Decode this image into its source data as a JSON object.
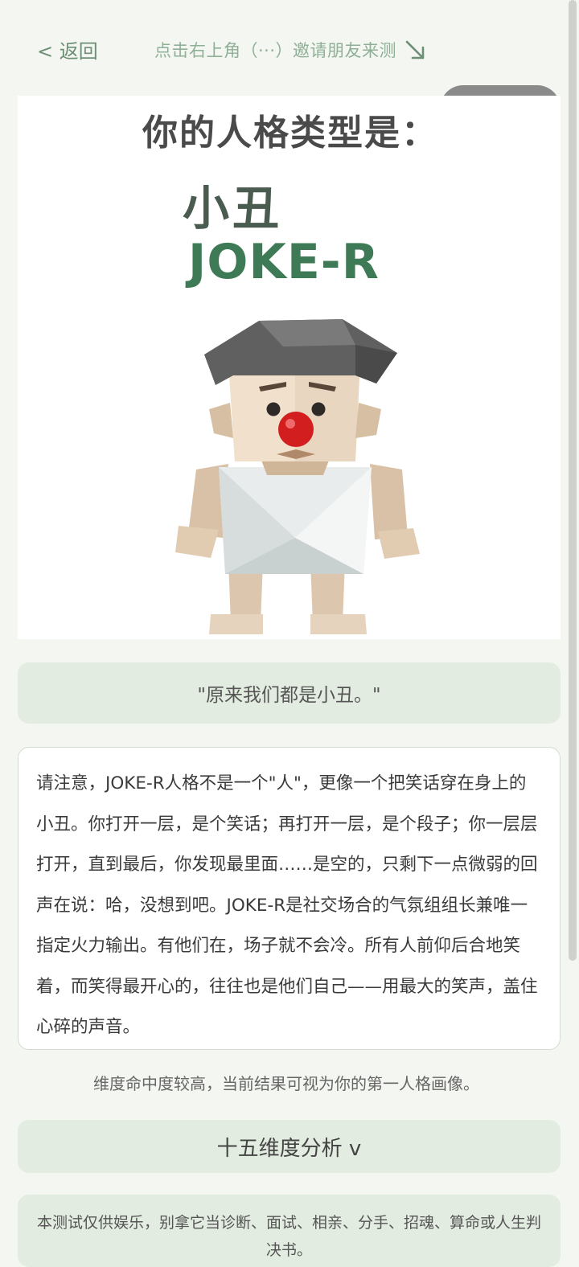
{
  "nav": {
    "back_label": "< 返回",
    "invite_text": "点击右上角（···）邀请朋友来测"
  },
  "hero": {
    "heading": "你的人格类型是：",
    "type_name": "小丑",
    "type_code": "JOKE-R"
  },
  "quote": "\"原来我们都是小丑。\"",
  "description": "请注意，JOKE-R人格不是一个\"人\"，更像一个把笑话穿在身上的小丑。你打开一层，是个笑话；再打开一层，是个段子；你一层层打开，直到最后，你发现最里面……是空的，只剩下一点微弱的回声在说：哈，没想到吧。JOKE-R是社交场合的气氛组组长兼唯一指定火力输出。有他们在，场子就不会冷。所有人前仰后合地笑着，而笑得最开心的，往往也是他们自己——用最大的笑声，盖住心碎的声音。",
  "match_note": "维度命中度较高，当前结果可视为你的第一人格画像。",
  "analysis_button": "十五维度分析 v",
  "disclaimer": "本测试仅供娱乐，别拿它当诊断、面试、相亲、分手、招魂、算命或人生判决书。",
  "icons": {
    "invite_arrow": "arrow-down-right-icon",
    "capsule_more": "more-dots-icon",
    "capsule_close": "target-close-icon"
  },
  "colors": {
    "accent": "#6d8f75",
    "card_bg": "#e3ece1",
    "code_green": "#3f7a56"
  }
}
